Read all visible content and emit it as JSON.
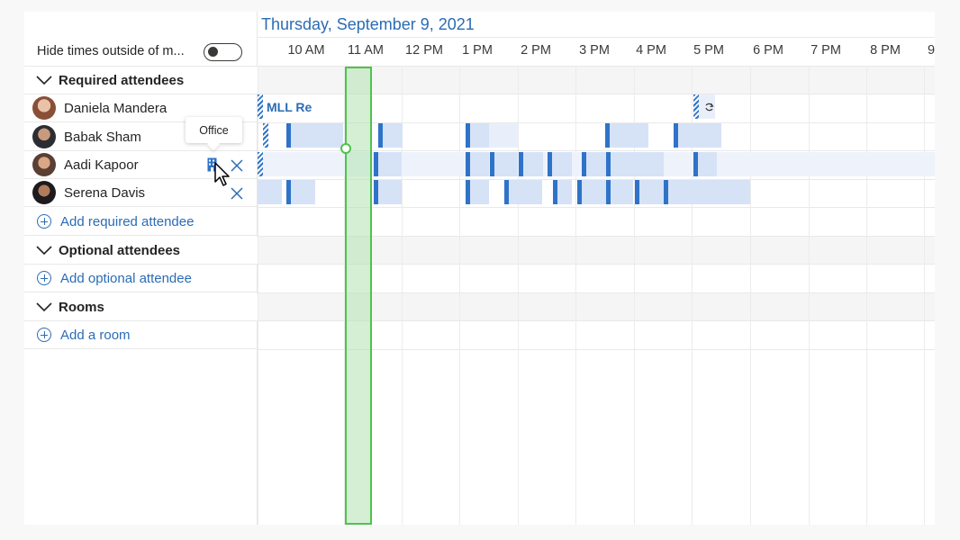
{
  "header": {
    "date": "Thursday, September 9, 2021",
    "hide_times_label": "Hide times outside of m...",
    "hide_times_enabled": false
  },
  "hours": [
    "10 AM",
    "11 AM",
    "12 PM",
    "1 PM",
    "2 PM",
    "3 PM",
    "4 PM",
    "5 PM",
    "6 PM",
    "7 PM",
    "8 PM",
    "9"
  ],
  "sections": {
    "required": "Required attendees",
    "optional": "Optional attendees",
    "rooms": "Rooms"
  },
  "attendees": [
    {
      "name": "Daniela Mandera"
    },
    {
      "name": "Babak Sham"
    },
    {
      "name": "Aadi Kapoor"
    },
    {
      "name": "Serena Davis"
    }
  ],
  "actions": {
    "add_required": "Add required attendee",
    "add_optional": "Add optional attendee",
    "add_room": "Add a room"
  },
  "tooltip": "Office",
  "events": {
    "daniela_event": "MLL Re"
  },
  "colors": {
    "accent": "#2b6cb5",
    "busy": "#d6e2f6",
    "busy_edge": "#2f73c9",
    "selection": "#4fc34b"
  }
}
